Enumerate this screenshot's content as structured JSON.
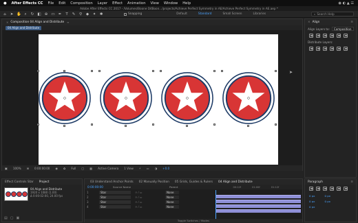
{
  "menubar": {
    "items": [
      "After Effects CC",
      "File",
      "Edit",
      "Composition",
      "Layer",
      "Effect",
      "Animation",
      "View",
      "Window",
      "Help"
    ]
  },
  "titlebar": {
    "title": "Adobe After Effects CC 2017 - /Volumes/Boone D4Boon.../projects/Achieve Perfect Symmetry in AE/Achieve Perfect Symmetry in AE.aep *"
  },
  "toolbar": {
    "snapping_label": "Snapping",
    "workspaces": [
      "Default",
      "Standard",
      "Small Screen",
      "Libraries"
    ],
    "active_workspace": "Standard",
    "search_placeholder": "Search Help"
  },
  "comp_panel": {
    "tab_label": "Composition 04 Align and Distribute",
    "breadcrumb": "04 Align and Distribute"
  },
  "viewer_controls": {
    "zoom": "100%",
    "timecode": "0:00:00:00",
    "resolution": "Full",
    "camera": "Active Camera",
    "view_layout": "1 View",
    "exposure": "+0.0"
  },
  "align_panel": {
    "title": "Align",
    "align_layers_to_label": "Align Layers to:",
    "align_layers_to_value": "Composition",
    "distribute_label": "Distribute Layers:"
  },
  "project_panel": {
    "tabs": [
      "Effect Controls Star",
      "Project"
    ],
    "item_name": "04 Align and Distribute",
    "item_info_1": "1920 x 1080 (1.00)",
    "item_info_2": "Δ 0:00:02:00, 24.00 fps"
  },
  "timeline": {
    "tabs": [
      "03 Understand Anchor Points",
      "02 Manually Position",
      "05 Grids, Guides & Rulers",
      "04 Align and Distribute"
    ],
    "active_tab": "04 Align and Distribute",
    "timecode": "0:00:00:00",
    "column_source_name": "Source Name",
    "column_parent": "Parent",
    "layers": [
      {
        "num": "1",
        "name": "Star",
        "parent": "None"
      },
      {
        "num": "2",
        "name": "Star",
        "parent": "None"
      },
      {
        "num": "3",
        "name": "Star",
        "parent": "None"
      },
      {
        "num": "4",
        "name": "Star",
        "parent": "None"
      }
    ],
    "ruler_marks": [
      "00:12f",
      "01:00f",
      "01:12f"
    ],
    "toggle_label": "Toggle Switches / Modes"
  },
  "paragraph_panel": {
    "title": "Paragraph",
    "values": [
      "0 px",
      "0 px",
      "0 px",
      "0 px",
      "0 px"
    ]
  },
  "colors": {
    "accent": "#4aa3ff",
    "star_fill": "#d83535",
    "star_ring": "#1e3b66",
    "layer_bar": "#8e8fd7"
  }
}
